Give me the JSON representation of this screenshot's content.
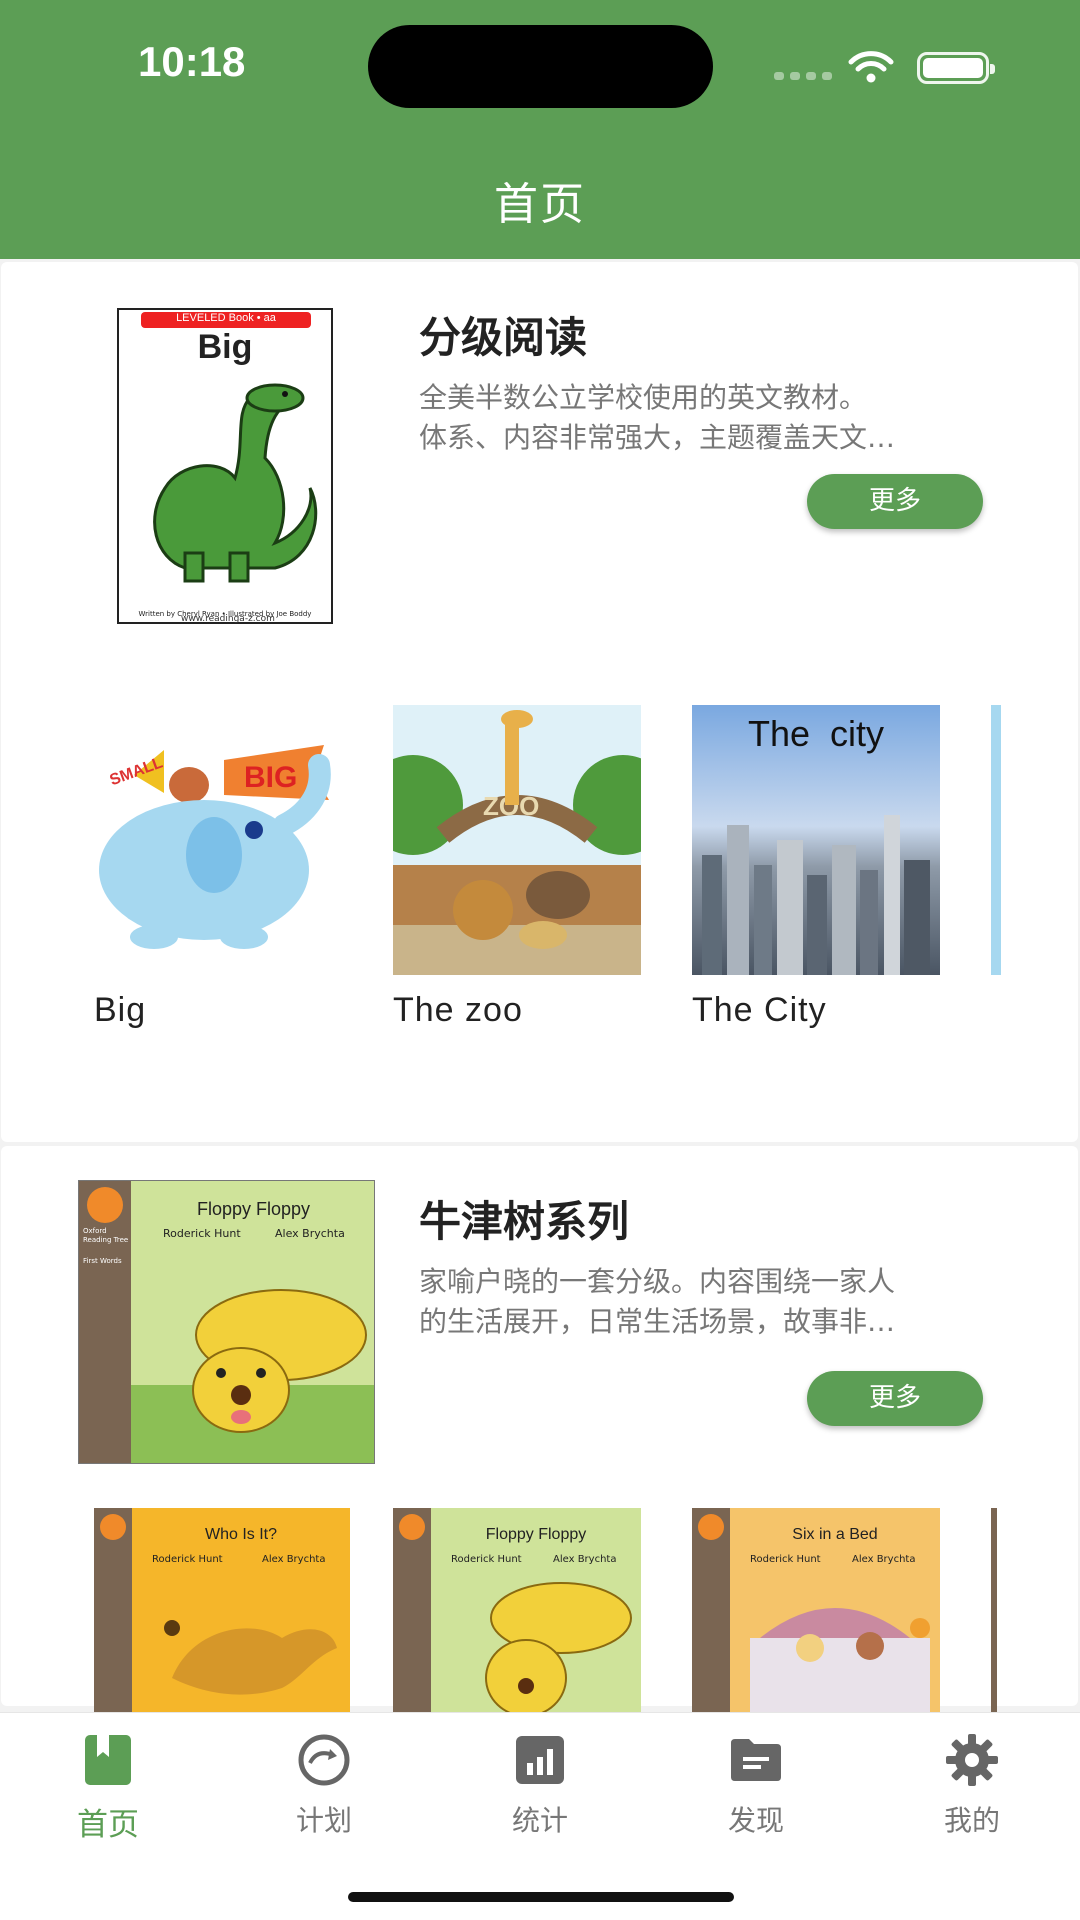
{
  "status_bar": {
    "time": "10:18"
  },
  "header": {
    "title": "首页"
  },
  "sections": [
    {
      "title": "分级阅读",
      "desc_lines": [
        "全美半数公立学校使用的英文教材。",
        "体系、内容非常强大，主题覆盖天文…"
      ],
      "more_label": "更多",
      "cover": {
        "tag": "LEVELED Book • aa",
        "title": "Big",
        "footer": "Written by Cheryl Ryan • Illustrated by Joe Boddy",
        "site": "www.readinga-z.com"
      },
      "books": [
        {
          "name": "Big",
          "flag_left": "SMALL",
          "flag_right": "BIG"
        },
        {
          "name": "The zoo",
          "sign": "ZOO"
        },
        {
          "name": "The City",
          "cover_text": "The  city"
        }
      ]
    },
    {
      "title": "牛津树系列",
      "desc_lines": [
        "家喻户晓的一套分级。内容围绕一家人",
        "的生活展开，日常生活场景，故事非…"
      ],
      "more_label": "更多",
      "cover": {
        "title": "Floppy Floppy",
        "author": "Roderick Hunt",
        "illustrator": "Alex Brychta",
        "series": "Oxford Reading Tree",
        "level": "First Words"
      },
      "books": [
        {
          "title": "Who Is It?",
          "author": "Roderick Hunt",
          "illustrator": "Alex Brychta"
        },
        {
          "title": "Floppy Floppy",
          "author": "Roderick Hunt",
          "illustrator": "Alex Brychta"
        },
        {
          "title": "Six in a Bed",
          "author": "Roderick Hunt",
          "illustrator": "Alex Brychta"
        }
      ]
    }
  ],
  "tabs": [
    {
      "label": "首页",
      "icon": "book-icon",
      "active": true
    },
    {
      "label": "计划",
      "icon": "refresh-icon",
      "active": false
    },
    {
      "label": "统计",
      "icon": "chart-icon",
      "active": false
    },
    {
      "label": "发现",
      "icon": "folder-icon",
      "active": false
    },
    {
      "label": "我的",
      "icon": "gear-icon",
      "active": false
    }
  ],
  "colors": {
    "primary": "#5c9e55",
    "text": "#222222",
    "muted": "#777777"
  }
}
